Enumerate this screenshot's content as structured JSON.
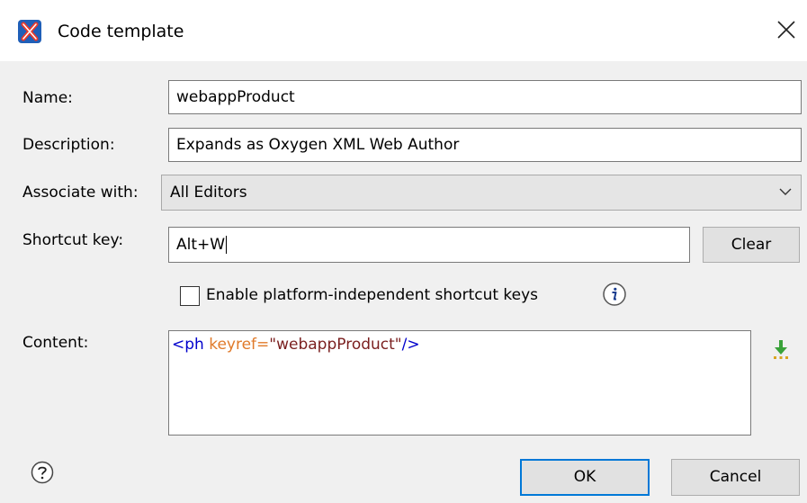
{
  "window": {
    "title": "Code template",
    "app_icon": "oxygen-x-logo-icon",
    "close_icon": "close-icon"
  },
  "form": {
    "name_label": "Name:",
    "name_value": "webappProduct",
    "description_label": "Description:",
    "description_value": "Expands as Oxygen XML Web Author",
    "associate_label": "Associate with:",
    "associate_value": "All Editors",
    "shortcut_label": "Shortcut key:",
    "shortcut_value": "Alt+W",
    "clear_label": "Clear",
    "platform_checkbox_label": "Enable platform-independent shortcut keys",
    "platform_checkbox_checked": false,
    "content_label": "Content:",
    "content": {
      "tag_open": "<ph",
      "space": " ",
      "attr": "keyref=",
      "value": "\"webappProduct\"",
      "tag_close": "/>"
    }
  },
  "footer": {
    "ok_label": "OK",
    "cancel_label": "Cancel"
  },
  "colors": {
    "accent": "#0078d7",
    "xml_tag": "#0000cc",
    "xml_attr": "#e07a2a",
    "xml_value": "#7a1f1f"
  }
}
